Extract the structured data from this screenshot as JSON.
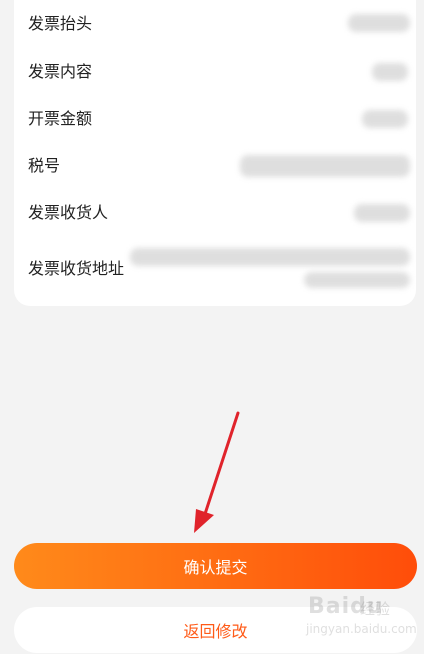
{
  "invoice": {
    "rows": [
      {
        "label": "发票抬头"
      },
      {
        "label": "发票内容"
      },
      {
        "label": "开票金额"
      },
      {
        "label": "税号"
      },
      {
        "label": "发票收货人"
      },
      {
        "label": "发票收货地址"
      }
    ]
  },
  "actions": {
    "confirm_label": "确认提交",
    "back_label": "返回修改"
  },
  "watermark": {
    "brand": "Baidu",
    "suffix": "经验",
    "url": "jingyan.baidu.com"
  },
  "colors": {
    "accent": "#ff6a12",
    "annotation_arrow": "#e0232b"
  }
}
